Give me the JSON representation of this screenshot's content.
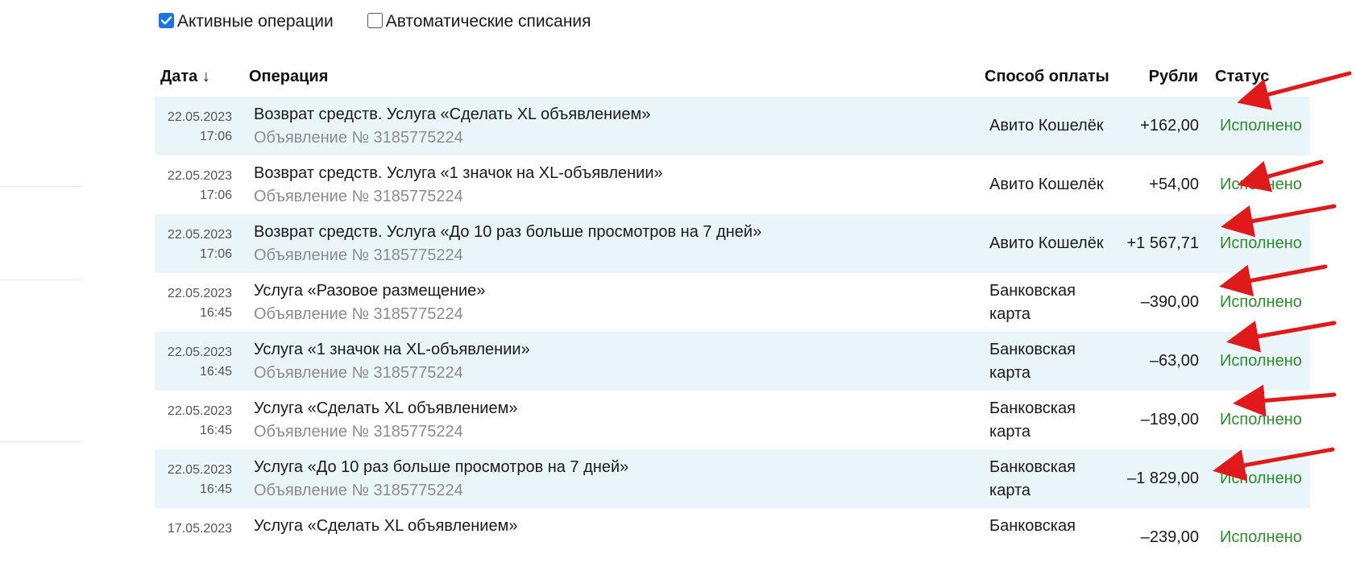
{
  "filters": {
    "active_label": "Активные операции",
    "active_checked": true,
    "auto_label": "Автоматические списания",
    "auto_checked": false
  },
  "table": {
    "headers": {
      "date": "Дата ↓",
      "operation": "Операция",
      "payment": "Способ оплаты",
      "rubles": "Рубли",
      "status": "Статус"
    },
    "rows": [
      {
        "date": "22.05.2023",
        "time": "17:06",
        "title": "Возврат средств. Услуга «Сделать XL объявлением»",
        "sub": "Объявление № 3185775224",
        "pay1": "Авито Кошелёк",
        "pay2": "",
        "amount": "+162,00",
        "status": "Исполнено"
      },
      {
        "date": "22.05.2023",
        "time": "17:06",
        "title": "Возврат средств. Услуга «1 значок на XL-объявлении»",
        "sub": "Объявление № 3185775224",
        "pay1": "Авито Кошелёк",
        "pay2": "",
        "amount": "+54,00",
        "status": "Исполнено"
      },
      {
        "date": "22.05.2023",
        "time": "17:06",
        "title": "Возврат средств. Услуга «До 10 раз больше просмотров на 7 дней»",
        "sub": "Объявление № 3185775224",
        "pay1": "Авито Кошелёк",
        "pay2": "",
        "amount": "+1 567,71",
        "status": "Исполнено"
      },
      {
        "date": "22.05.2023",
        "time": "16:45",
        "title": "Услуга «Разовое размещение»",
        "sub": "Объявление № 3185775224",
        "pay1": "Банковская",
        "pay2": "карта",
        "amount": "–390,00",
        "status": "Исполнено"
      },
      {
        "date": "22.05.2023",
        "time": "16:45",
        "title": "Услуга «1 значок на XL-объявлении»",
        "sub": "Объявление № 3185775224",
        "pay1": "Банковская",
        "pay2": "карта",
        "amount": "–63,00",
        "status": "Исполнено"
      },
      {
        "date": "22.05.2023",
        "time": "16:45",
        "title": "Услуга «Сделать XL объявлением»",
        "sub": "Объявление № 3185775224",
        "pay1": "Банковская",
        "pay2": "карта",
        "amount": "–189,00",
        "status": "Исполнено"
      },
      {
        "date": "22.05.2023",
        "time": "16:45",
        "title": "Услуга «До 10 раз больше просмотров на 7 дней»",
        "sub": "Объявление № 3185775224",
        "pay1": "Банковская",
        "pay2": "карта",
        "amount": "–1 829,00",
        "status": "Исполнено"
      },
      {
        "date": "17.05.2023",
        "time": "",
        "title": "Услуга «Сделать XL объявлением»",
        "sub": "",
        "pay1": "Банковская",
        "pay2": "",
        "amount": "–239,00",
        "status": "Исполнено"
      }
    ]
  },
  "colors": {
    "row_shade": "#eaf5f9",
    "status_ok": "#2e8a2e",
    "annotation_arrow": "#e0191b",
    "checkbox_accent": "#1a73e8"
  }
}
